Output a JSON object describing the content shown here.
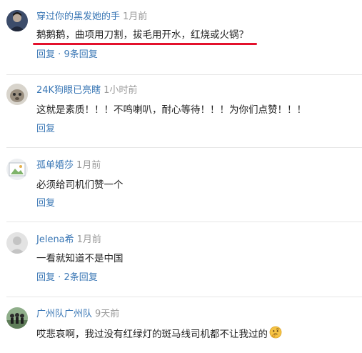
{
  "comments": [
    {
      "username": "穿过你的黑发她的手",
      "time": "1月前",
      "text": "鹅鹅鹅，曲项用刀割，拔毛用开水，红烧或火锅？",
      "reply": "回复",
      "separator": "·",
      "replies_count": "9条回复",
      "highlighted": true,
      "highlight_color": "#e3112c"
    },
    {
      "username": "24K狗眼已亮瞎",
      "time": "1小时前",
      "text": "这就是素质！！！不鸣喇叭，耐心等待！！！为你们点赞！！！",
      "reply": "回复"
    },
    {
      "username": "孤单婚莎",
      "time": "1月前",
      "text": "必须给司机们赞一个",
      "reply": "回复"
    },
    {
      "username": "Jelena希",
      "time": "1月前",
      "text": "一看就知道不是中国",
      "reply": "回复",
      "separator": "·",
      "replies_count": "2条回复"
    },
    {
      "username": "广州队广州队",
      "time": "9天前",
      "text": "哎悲哀啊，我过没有红绿灯的斑马线司机都不让我过的",
      "emoji": "thinking-face-emoji"
    }
  ],
  "colors": {
    "link": "#3a77b5",
    "meta": "#999999",
    "text": "#222222",
    "divider": "#e6e6e6"
  }
}
